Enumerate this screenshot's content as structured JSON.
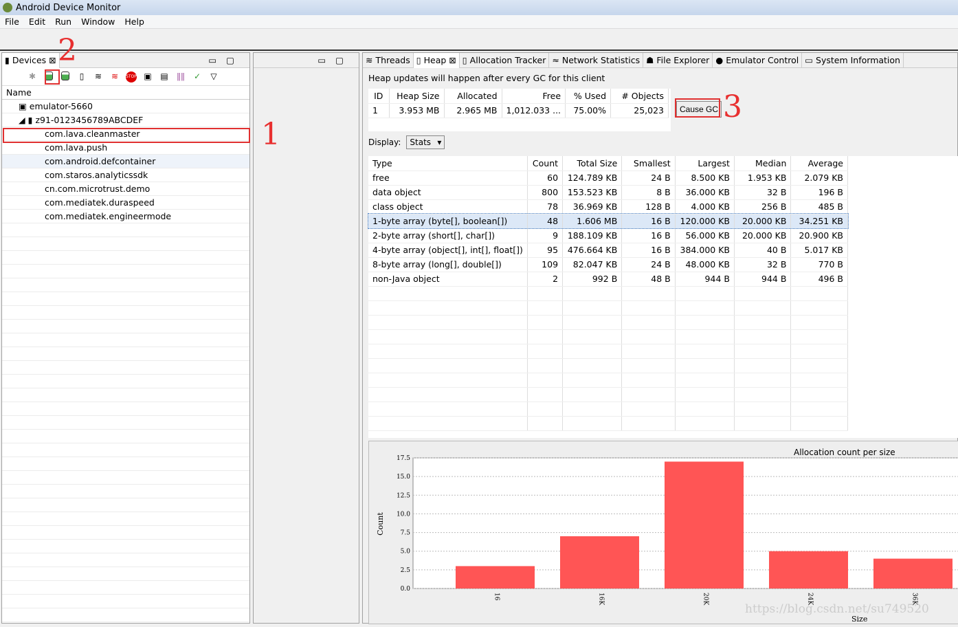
{
  "window": {
    "title": "Android Device Monitor"
  },
  "menu": [
    "File",
    "Edit",
    "Run",
    "Window",
    "Help"
  ],
  "devices": {
    "tab_label": "Devices",
    "column": "Name",
    "items": [
      {
        "label": "emulator-5660",
        "level": 0
      },
      {
        "label": "z91-0123456789ABCDEF",
        "level": 0
      },
      {
        "label": "com.lava.cleanmaster",
        "level": 1
      },
      {
        "label": "com.lava.push",
        "level": 1
      },
      {
        "label": "com.android.defcontainer",
        "level": 1
      },
      {
        "label": "com.staros.analyticssdk",
        "level": 1
      },
      {
        "label": "cn.com.microtrust.demo",
        "level": 1
      },
      {
        "label": "com.mediatek.duraspeed",
        "level": 1
      },
      {
        "label": "com.mediatek.engineermode",
        "level": 1
      }
    ]
  },
  "tabs": [
    "Threads",
    "Heap",
    "Allocation Tracker",
    "Network Statistics",
    "File Explorer",
    "Emulator Control",
    "System Information"
  ],
  "heap": {
    "info": "Heap updates will happen after every GC for this client",
    "summary_headers": [
      "ID",
      "Heap Size",
      "Allocated",
      "Free",
      "% Used",
      "# Objects"
    ],
    "summary_row": [
      "1",
      "3.953 MB",
      "2.965 MB",
      "1,012.033 ...",
      "75.00%",
      "25,023"
    ],
    "cause_gc": "Cause GC",
    "display_label": "Display:",
    "display_value": "Stats",
    "headers": [
      "Type",
      "Count",
      "Total Size",
      "Smallest",
      "Largest",
      "Median",
      "Average"
    ],
    "rows": [
      [
        "free",
        "60",
        "124.789 KB",
        "24 B",
        "8.500 KB",
        "1.953 KB",
        "2.079 KB"
      ],
      [
        "data object",
        "800",
        "153.523 KB",
        "8 B",
        "36.000 KB",
        "32 B",
        "196 B"
      ],
      [
        "class object",
        "78",
        "36.969 KB",
        "128 B",
        "4.000 KB",
        "256 B",
        "485 B"
      ],
      [
        "1-byte array (byte[], boolean[])",
        "48",
        "1.606 MB",
        "16 B",
        "120.000 KB",
        "20.000 KB",
        "34.251 KB"
      ],
      [
        "2-byte array (short[], char[])",
        "9",
        "188.109 KB",
        "16 B",
        "56.000 KB",
        "20.000 KB",
        "20.900 KB"
      ],
      [
        "4-byte array (object[], int[], float[])",
        "95",
        "476.664 KB",
        "16 B",
        "384.000 KB",
        "40 B",
        "5.017 KB"
      ],
      [
        "8-byte array (long[], double[])",
        "109",
        "82.047 KB",
        "24 B",
        "48.000 KB",
        "32 B",
        "770 B"
      ],
      [
        "non-Java object",
        "2",
        "992 B",
        "48 B",
        "944 B",
        "944 B",
        "496 B"
      ]
    ]
  },
  "annotations": [
    "1",
    "2",
    "3"
  ],
  "watermark": "https://blog.csdn.net/su749520",
  "chart_data": {
    "type": "bar",
    "title": "Allocation count per size",
    "xlabel": "Size",
    "ylabel": "Count",
    "categories": [
      "16",
      "16K",
      "20K",
      "24K",
      "36K"
    ],
    "values": [
      3,
      7,
      17,
      5,
      4
    ],
    "ylim": [
      0,
      17.5
    ],
    "yticks": [
      "0.0",
      "2.5",
      "5.0",
      "7.5",
      "10.0",
      "12.5",
      "15.0",
      "17.5"
    ],
    "color": "#ff5555",
    "grid": true
  }
}
